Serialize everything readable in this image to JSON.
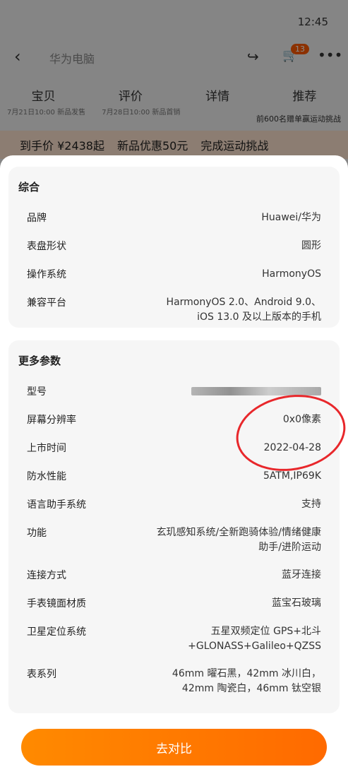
{
  "background": {
    "time": "12:45",
    "search_placeholder": "华为电脑",
    "cart_count": "13",
    "tabs": [
      "宝贝",
      "评价",
      "详情",
      "推荐"
    ],
    "meta_left": "7月21日10:00 新品发售",
    "meta_mid": "7月28日10:00 新品首销",
    "meta_right": "前600名赠单赢运动挑战",
    "promo": [
      "到手价 ¥2438起",
      "新品优惠50元",
      "完成运动挑战"
    ]
  },
  "card1": {
    "title": "综合",
    "rows": [
      {
        "label": "品牌",
        "value": "Huawei/华为"
      },
      {
        "label": "表盘形状",
        "value": "圆形"
      },
      {
        "label": "操作系统",
        "value": "HarmonyOS"
      },
      {
        "label": "兼容平台",
        "value": "HarmonyOS 2.0、Android 9.0、iOS 13.0 及以上版本的手机"
      }
    ]
  },
  "card2": {
    "title": "更多参数",
    "rows": [
      {
        "label": "型号",
        "value": ""
      },
      {
        "label": "屏幕分辨率",
        "value": "0x0像素"
      },
      {
        "label": "上市时间",
        "value": "2022-04-28"
      },
      {
        "label": "防水性能",
        "value": "5ATM,IP69K"
      },
      {
        "label": "语言助手系统",
        "value": "支持"
      },
      {
        "label": "功能",
        "value": "玄玑感知系统/全新跑骑体验/情绪健康助手/进阶运动"
      },
      {
        "label": "连接方式",
        "value": "蓝牙连接"
      },
      {
        "label": "手表镜面材质",
        "value": "蓝宝石玻璃"
      },
      {
        "label": "卫星定位系统",
        "value": "五星双频定位 GPS+北斗+GLONASS+Galileo+QZSS"
      },
      {
        "label": "表系列",
        "value": "46mm 曜石黑，42mm 冰川白，42mm 陶瓷白，46mm 钛空银"
      }
    ]
  },
  "button": {
    "label": "去对比"
  },
  "colors": {
    "accent": "#ff7a00",
    "highlight_circle": "#e8272b"
  }
}
